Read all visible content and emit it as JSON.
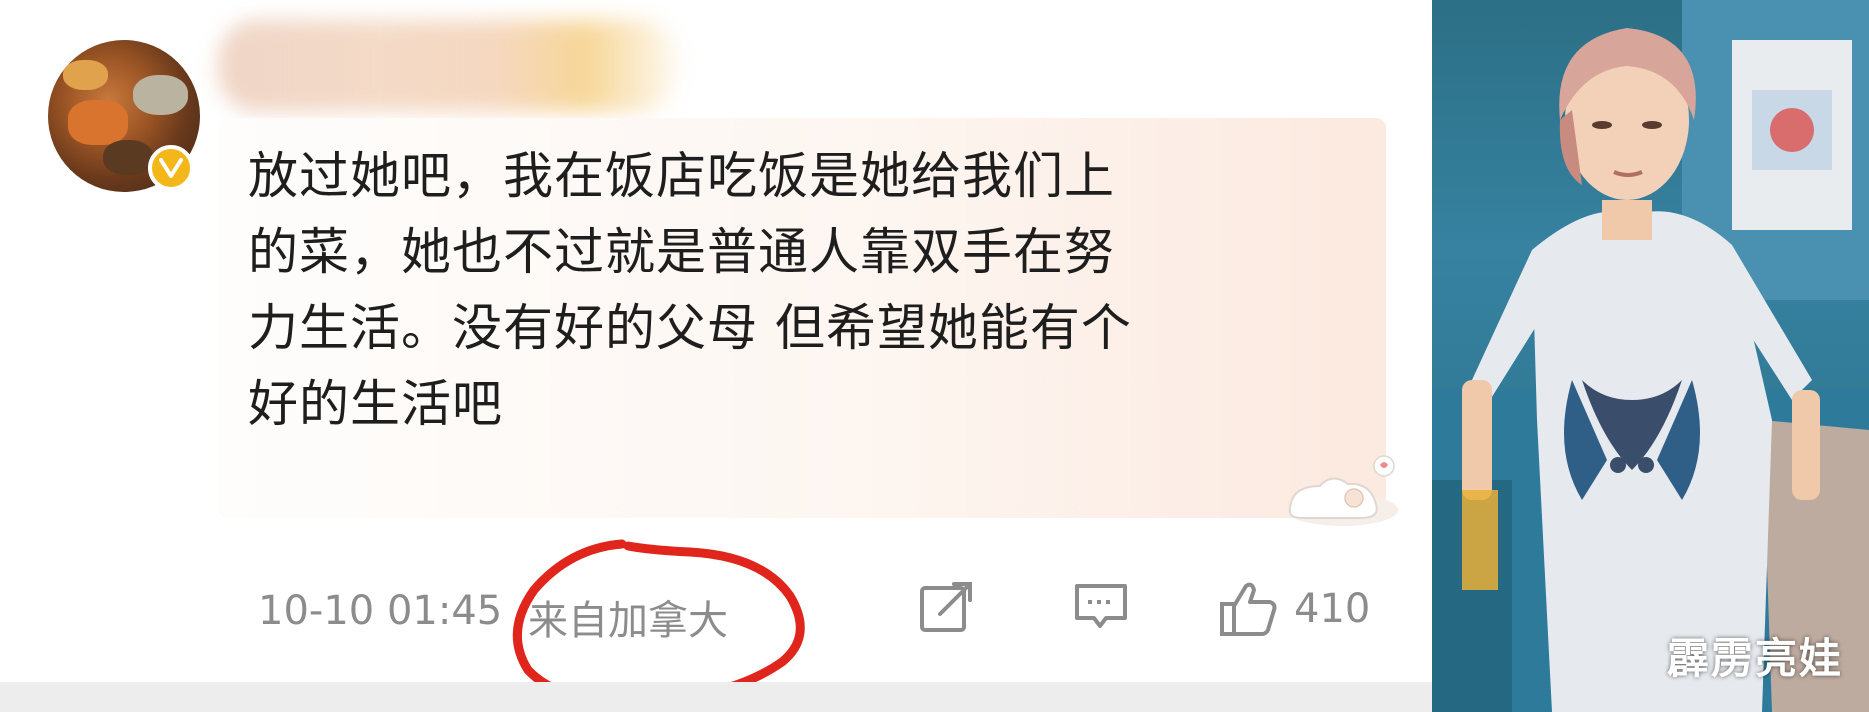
{
  "comment": {
    "avatar_icon": "food-avatar",
    "badge_icon": "verified-v-icon",
    "badge_color": "#f4b71a",
    "text_lines": [
      "放过她吧，我在饭店吃饭是她给我们上",
      "的菜，她也不过就是普通人靠双手在努",
      "力生活。没有好的父母 但希望她能有个",
      "好的生活吧"
    ],
    "timestamp": "10-10 01:45",
    "location": "来自加拿大",
    "like_count": "410",
    "highlight_color": "#e0261c"
  },
  "photo": {
    "watermark": "霹雳亮娃"
  }
}
